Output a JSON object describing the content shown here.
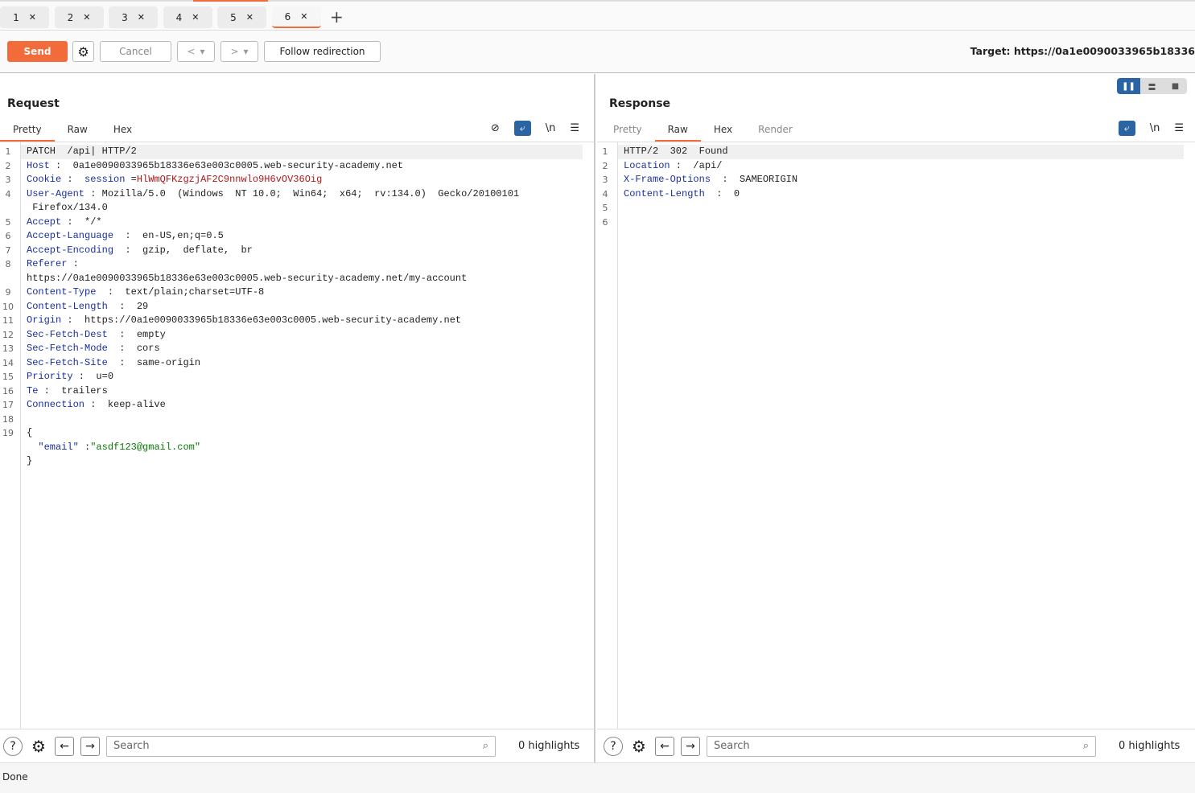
{
  "tabs": [
    {
      "label": "1"
    },
    {
      "label": "2"
    },
    {
      "label": "3"
    },
    {
      "label": "4"
    },
    {
      "label": "5"
    },
    {
      "label": "6",
      "active": true
    }
  ],
  "toolbar": {
    "send": "Send",
    "cancel": "Cancel",
    "prev": "<",
    "next": ">",
    "dropdown": "▾",
    "follow": "Follow redirection",
    "target": "Target: https://0a1e0090033965b18336"
  },
  "request": {
    "title": "Request",
    "tabs": [
      "Pretty",
      "Raw",
      "Hex"
    ],
    "active_tab": "Pretty",
    "newline_label": "\\n",
    "lines": [
      {
        "n": "1",
        "tokens": [
          {
            "t": "PATCH  /api",
            "c": "v"
          },
          {
            "t": "| HTTP/2",
            "c": "v"
          }
        ]
      },
      {
        "n": "2",
        "tokens": [
          {
            "t": "Host",
            "c": "k"
          },
          {
            "t": " :  0a1e0090033965b18336e63e003c0005.web-security-academy.net",
            "c": "v"
          }
        ]
      },
      {
        "n": "3",
        "tokens": [
          {
            "t": "Cookie",
            "c": "k"
          },
          {
            "t": " :  ",
            "c": "v"
          },
          {
            "t": "session",
            "c": "s"
          },
          {
            "t": " =",
            "c": "v"
          },
          {
            "t": "HlWmQFKzgzjAF2C9nnwlo9H6vOV36Oig",
            "c": "r"
          }
        ]
      },
      {
        "n": "4",
        "tokens": [
          {
            "t": "User-Agent",
            "c": "k"
          },
          {
            "t": " : Mozilla/5.0  (Windows  NT 10.0;  Win64;  x64;  rv:134.0)  Gecko/20100101\n Firefox/134.0",
            "c": "v"
          }
        ]
      },
      {
        "n": "5",
        "tokens": [
          {
            "t": "Accept",
            "c": "k"
          },
          {
            "t": " :  */*",
            "c": "v"
          }
        ]
      },
      {
        "n": "6",
        "tokens": [
          {
            "t": "Accept-Language",
            "c": "k"
          },
          {
            "t": "  :  en-US,en;q=0.5",
            "c": "v"
          }
        ]
      },
      {
        "n": "7",
        "tokens": [
          {
            "t": "Accept-Encoding",
            "c": "k"
          },
          {
            "t": "  :  gzip,  deflate,  br",
            "c": "v"
          }
        ]
      },
      {
        "n": "8",
        "tokens": [
          {
            "t": "Referer",
            "c": "k"
          },
          {
            "t": " :\nhttps://0a1e0090033965b18336e63e003c0005.web-security-academy.net/my-account",
            "c": "v"
          }
        ]
      },
      {
        "n": "9",
        "tokens": [
          {
            "t": "Content-Type",
            "c": "k"
          },
          {
            "t": "  :  text/plain;charset=UTF-8",
            "c": "v"
          }
        ]
      },
      {
        "n": "10",
        "tokens": [
          {
            "t": "Content-Length",
            "c": "k"
          },
          {
            "t": "  :  29",
            "c": "v"
          }
        ]
      },
      {
        "n": "11",
        "tokens": [
          {
            "t": "Origin",
            "c": "k"
          },
          {
            "t": " :  https://0a1e0090033965b18336e63e003c0005.web-security-academy.net",
            "c": "v"
          }
        ]
      },
      {
        "n": "12",
        "tokens": [
          {
            "t": "Sec-Fetch-Dest",
            "c": "k"
          },
          {
            "t": "  :  empty",
            "c": "v"
          }
        ]
      },
      {
        "n": "13",
        "tokens": [
          {
            "t": "Sec-Fetch-Mode",
            "c": "k"
          },
          {
            "t": "  :  cors",
            "c": "v"
          }
        ]
      },
      {
        "n": "14",
        "tokens": [
          {
            "t": "Sec-Fetch-Site",
            "c": "k"
          },
          {
            "t": "  :  same-origin",
            "c": "v"
          }
        ]
      },
      {
        "n": "15",
        "tokens": [
          {
            "t": "Priority",
            "c": "k"
          },
          {
            "t": " :  u=0",
            "c": "v"
          }
        ]
      },
      {
        "n": "16",
        "tokens": [
          {
            "t": "Te",
            "c": "k"
          },
          {
            "t": " :  trailers",
            "c": "v"
          }
        ]
      },
      {
        "n": "17",
        "tokens": [
          {
            "t": "Connection",
            "c": "k"
          },
          {
            "t": " :  keep-alive",
            "c": "v"
          }
        ]
      },
      {
        "n": "18",
        "tokens": [
          {
            "t": "",
            "c": "v"
          }
        ]
      },
      {
        "n": "19",
        "tokens": [
          {
            "t": "{\n  ",
            "c": "v"
          },
          {
            "t": "\"email\"",
            "c": "k"
          },
          {
            "t": " :",
            "c": "v"
          },
          {
            "t": "\"asdf123@gmail.com\"",
            "c": "g"
          },
          {
            "t": "\n}",
            "c": "v"
          }
        ]
      }
    ],
    "search_placeholder": "Search",
    "highlights": "0 highlights"
  },
  "response": {
    "title": "Response",
    "tabs": [
      "Pretty",
      "Raw",
      "Hex",
      "Render"
    ],
    "active_tab": "Raw",
    "newline_label": "\\n",
    "lines": [
      {
        "n": "1",
        "tokens": [
          {
            "t": "HTTP/2  302  Found",
            "c": "v"
          }
        ]
      },
      {
        "n": "2",
        "tokens": [
          {
            "t": "Location",
            "c": "k"
          },
          {
            "t": " :  /api/",
            "c": "v"
          }
        ]
      },
      {
        "n": "3",
        "tokens": [
          {
            "t": "X-Frame-Options",
            "c": "k"
          },
          {
            "t": "  :  SAMEORIGIN",
            "c": "v"
          }
        ]
      },
      {
        "n": "4",
        "tokens": [
          {
            "t": "Content-Length",
            "c": "k"
          },
          {
            "t": "  :  0",
            "c": "v"
          }
        ]
      },
      {
        "n": "5",
        "tokens": [
          {
            "t": "",
            "c": "v"
          }
        ]
      },
      {
        "n": "6",
        "tokens": [
          {
            "t": "",
            "c": "v"
          }
        ]
      }
    ],
    "search_placeholder": "Search",
    "highlights": "0 highlights"
  },
  "status": "Done",
  "colors": {
    "accent": "#f26b3a",
    "blue": "#2b64a3"
  }
}
